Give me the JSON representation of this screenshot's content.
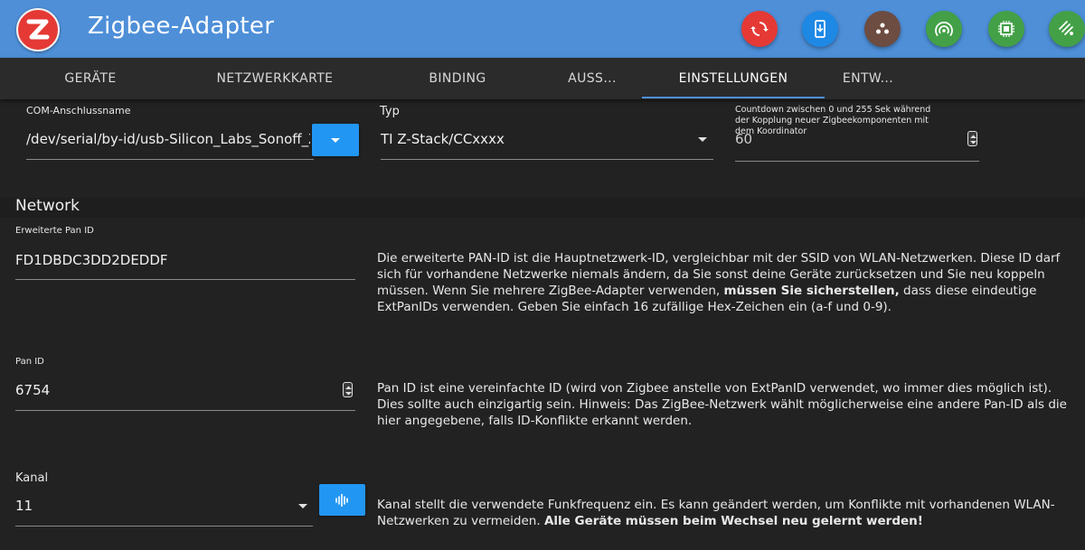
{
  "app": {
    "title": "Zigbee-Adapter",
    "logo_icon": "zigbee-logo",
    "header_buttons": [
      {
        "name": "refresh-icon",
        "color": "#e53935"
      },
      {
        "name": "device-install-icon",
        "color": "#1e88e5"
      },
      {
        "name": "cookie-icon",
        "color": "#6d4c41"
      },
      {
        "name": "signal-icon",
        "color": "#43a047"
      },
      {
        "name": "chip-icon",
        "color": "#43a047"
      },
      {
        "name": "wifi-strength-icon",
        "color": "#43a047"
      }
    ]
  },
  "tabs": [
    {
      "label": "GERÄTE"
    },
    {
      "label": "NETZWERKKARTE"
    },
    {
      "label": "BINDING"
    },
    {
      "label": "AUSS..."
    },
    {
      "label": "EINSTELLUNGEN",
      "active": true
    },
    {
      "label": "ENTW..."
    }
  ],
  "fields": {
    "com_port": {
      "label": "COM-Anschlussname",
      "value": "/dev/serial/by-id/usb-Silicon_Labs_Sonoff_Zi"
    },
    "type": {
      "label": "Typ",
      "value": "TI Z-Stack/CCxxxx"
    },
    "countdown": {
      "label": "Countdown zwischen 0 und 255 Sek während der Kopplung neuer Zigbeekomponenten mit dem Koordinator",
      "value": "60"
    }
  },
  "network": {
    "title": "Network",
    "ext_pan_id": {
      "label": "Erweiterte Pan ID",
      "value": "FD1DBDC3DD2DEDDF",
      "desc_1": "Die erweiterte PAN-ID ist die Hauptnetzwerk-ID, vergleichbar mit der SSID von WLAN-Netzwerken. Diese ID darf sich für vorhandene Netzwerke niemals ändern, da Sie sonst deine Geräte zurücksetzen und Sie neu koppeln müssen. Wenn Sie mehrere ZigBee-Adapter verwenden, ",
      "desc_bold": "müssen Sie sicherstellen,",
      "desc_2": " dass diese eindeutige ExtPanIDs verwenden. Geben Sie einfach 16 zufällige Hex-Zeichen ein (a-f und 0-9)."
    },
    "pan_id": {
      "label": "Pan ID",
      "value": "6754",
      "desc": "Pan ID ist eine vereinfachte ID (wird von Zigbee anstelle von ExtPanID verwendet, wo immer dies möglich ist). Dies sollte auch einzigartig sein. Hinweis: Das ZigBee-Netzwerk wählt möglicherweise eine andere Pan-ID als die hier angegebene, falls ID-Konflikte erkannt werden."
    },
    "channel": {
      "label": "Kanal",
      "value": "11",
      "desc_1": "Kanal stellt die verwendete Funkfrequenz ein. Es kann geändert werden, um Konflikte mit vorhandenen WLAN-Netzwerken zu vermeiden. ",
      "desc_bold": "Alle Geräte müssen beim Wechsel neu gelernt werden!"
    }
  }
}
